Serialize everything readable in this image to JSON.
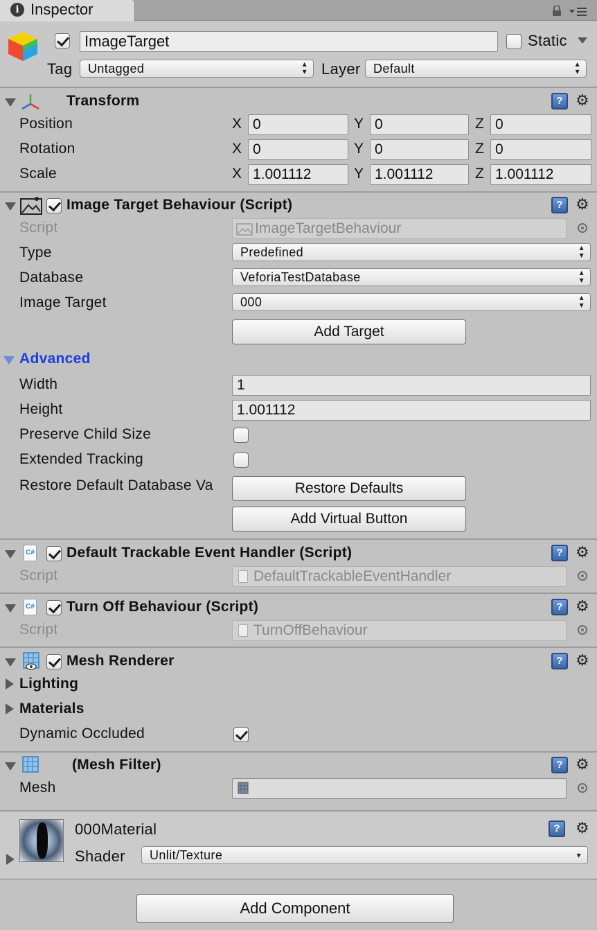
{
  "tab": {
    "title": "Inspector"
  },
  "header": {
    "active_checked": true,
    "object_name": "ImageTarget",
    "static_label": "Static",
    "tag_label": "Tag",
    "tag_value": "Untagged",
    "layer_label": "Layer",
    "layer_value": "Default"
  },
  "transform": {
    "title": "Transform",
    "axes": {
      "x": "X",
      "y": "Y",
      "z": "Z"
    },
    "position": {
      "label": "Position",
      "x": "0",
      "y": "0",
      "z": "0"
    },
    "rotation": {
      "label": "Rotation",
      "x": "0",
      "y": "0",
      "z": "0"
    },
    "scale": {
      "label": "Scale",
      "x": "1.001112",
      "y": "1.001112",
      "z": "1.001112"
    }
  },
  "image_target": {
    "title": "Image Target Behaviour (Script)",
    "script_label": "Script",
    "script_value": "ImageTargetBehaviour",
    "type_label": "Type",
    "type_value": "Predefined",
    "database_label": "Database",
    "database_value": "VeforiaTestDatabase",
    "image_target_label": "Image Target",
    "image_target_value": "000",
    "add_target_button": "Add Target",
    "advanced_label": "Advanced",
    "width_label": "Width",
    "width_value": "1",
    "height_label": "Height",
    "height_value": "1.001112",
    "preserve_label": "Preserve Child Size",
    "preserve_checked": false,
    "extended_label": "Extended Tracking",
    "extended_checked": false,
    "restore_label": "Restore Default Database Va",
    "restore_button": "Restore Defaults",
    "add_virtual_button": "Add Virtual Button"
  },
  "default_handler": {
    "title": "Default Trackable Event Handler (Script)",
    "script_label": "Script",
    "script_value": "DefaultTrackableEventHandler"
  },
  "turn_off": {
    "title": "Turn Off Behaviour (Script)",
    "script_label": "Script",
    "script_value": "TurnOffBehaviour"
  },
  "mesh_renderer": {
    "title": "Mesh Renderer",
    "lighting_label": "Lighting",
    "materials_label": "Materials",
    "dynamic_occluded_label": "Dynamic Occluded",
    "dynamic_occluded_checked": true
  },
  "mesh_filter": {
    "title": "(Mesh Filter)",
    "mesh_label": "Mesh",
    "mesh_value": ""
  },
  "material": {
    "name": "000Material",
    "shader_label": "Shader",
    "shader_value": "Unlit/Texture"
  },
  "add_component_button": "Add Component",
  "icons": {
    "csharp": "C#",
    "help": "?",
    "gear": "⚙",
    "info": "i"
  },
  "colors": {
    "background": "#c2c2c2",
    "advanced_link": "#1e3ce0",
    "help_icon": "#3a66a8"
  }
}
